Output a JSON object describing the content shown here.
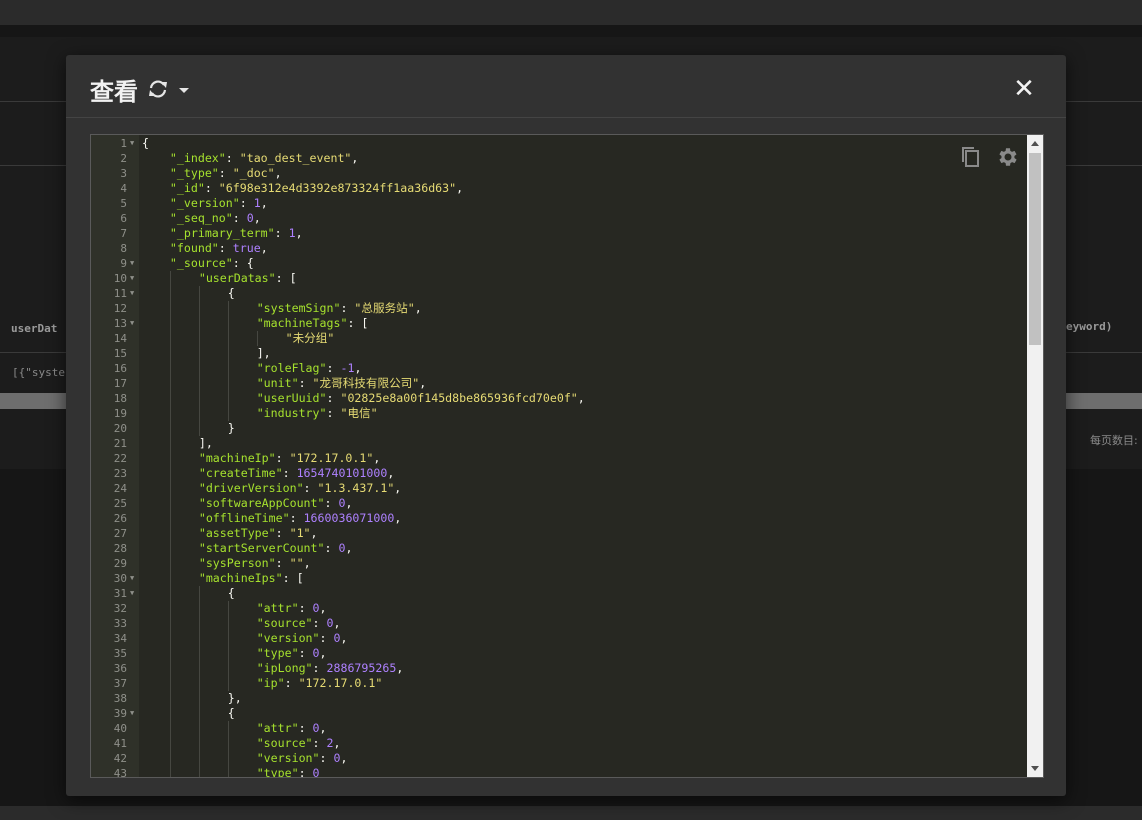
{
  "background": {
    "table_header_left": "userDat",
    "table_header_right": "eyword)",
    "table_cell_left": "[{\"syste",
    "pagination_label": "每页数目:"
  },
  "modal": {
    "title": "查看",
    "refresh_icon": "refresh-icon",
    "close_label": "✕"
  },
  "editor": {
    "copy_icon": "copy-icon",
    "settings_icon": "gear-icon",
    "colors": {
      "background": "#272822",
      "key": "#a6e22e",
      "string": "#e6db74",
      "number": "#ae81ff",
      "punctuation": "#f8f8f2"
    },
    "lines": [
      {
        "n": "1",
        "fold": true,
        "indent": 0,
        "tokens": [
          [
            "p",
            "{"
          ]
        ]
      },
      {
        "n": "2",
        "indent": 1,
        "tokens": [
          [
            "k",
            "\"_index\""
          ],
          [
            "p",
            ": "
          ],
          [
            "s",
            "\"tao_dest_event\""
          ],
          [
            "p",
            ","
          ]
        ]
      },
      {
        "n": "3",
        "indent": 1,
        "tokens": [
          [
            "k",
            "\"_type\""
          ],
          [
            "p",
            ": "
          ],
          [
            "s",
            "\"_doc\""
          ],
          [
            "p",
            ","
          ]
        ]
      },
      {
        "n": "4",
        "indent": 1,
        "tokens": [
          [
            "k",
            "\"_id\""
          ],
          [
            "p",
            ": "
          ],
          [
            "s",
            "\"6f98e312e4d3392e873324ff1aa36d63\""
          ],
          [
            "p",
            ","
          ]
        ]
      },
      {
        "n": "5",
        "indent": 1,
        "tokens": [
          [
            "k",
            "\"_version\""
          ],
          [
            "p",
            ": "
          ],
          [
            "n",
            "1"
          ],
          [
            "p",
            ","
          ]
        ]
      },
      {
        "n": "6",
        "indent": 1,
        "tokens": [
          [
            "k",
            "\"_seq_no\""
          ],
          [
            "p",
            ": "
          ],
          [
            "n",
            "0"
          ],
          [
            "p",
            ","
          ]
        ]
      },
      {
        "n": "7",
        "indent": 1,
        "tokens": [
          [
            "k",
            "\"_primary_term\""
          ],
          [
            "p",
            ": "
          ],
          [
            "n",
            "1"
          ],
          [
            "p",
            ","
          ]
        ]
      },
      {
        "n": "8",
        "indent": 1,
        "tokens": [
          [
            "k",
            "\"found\""
          ],
          [
            "p",
            ": "
          ],
          [
            "n",
            "true"
          ],
          [
            "p",
            ","
          ]
        ]
      },
      {
        "n": "9",
        "fold": true,
        "indent": 1,
        "tokens": [
          [
            "k",
            "\"_source\""
          ],
          [
            "p",
            ": {"
          ]
        ]
      },
      {
        "n": "10",
        "fold": true,
        "indent": 2,
        "tokens": [
          [
            "k",
            "\"userDatas\""
          ],
          [
            "p",
            ": ["
          ]
        ]
      },
      {
        "n": "11",
        "fold": true,
        "indent": 3,
        "tokens": [
          [
            "p",
            "{"
          ]
        ]
      },
      {
        "n": "12",
        "indent": 4,
        "tokens": [
          [
            "k",
            "\"systemSign\""
          ],
          [
            "p",
            ": "
          ],
          [
            "s",
            "\"总服务站\""
          ],
          [
            "p",
            ","
          ]
        ]
      },
      {
        "n": "13",
        "fold": true,
        "indent": 4,
        "tokens": [
          [
            "k",
            "\"machineTags\""
          ],
          [
            "p",
            ": ["
          ]
        ]
      },
      {
        "n": "14",
        "indent": 5,
        "tokens": [
          [
            "s",
            "\"未分组\""
          ]
        ]
      },
      {
        "n": "15",
        "indent": 4,
        "tokens": [
          [
            "p",
            "],"
          ]
        ]
      },
      {
        "n": "16",
        "indent": 4,
        "tokens": [
          [
            "k",
            "\"roleFlag\""
          ],
          [
            "p",
            ": "
          ],
          [
            "n",
            "-1"
          ],
          [
            "p",
            ","
          ]
        ]
      },
      {
        "n": "17",
        "indent": 4,
        "tokens": [
          [
            "k",
            "\"unit\""
          ],
          [
            "p",
            ": "
          ],
          [
            "s",
            "\"龙哥科技有限公司\""
          ],
          [
            "p",
            ","
          ]
        ]
      },
      {
        "n": "18",
        "indent": 4,
        "tokens": [
          [
            "k",
            "\"userUuid\""
          ],
          [
            "p",
            ": "
          ],
          [
            "s",
            "\"02825e8a00f145d8be865936fcd70e0f\""
          ],
          [
            "p",
            ","
          ]
        ]
      },
      {
        "n": "19",
        "indent": 4,
        "tokens": [
          [
            "k",
            "\"industry\""
          ],
          [
            "p",
            ": "
          ],
          [
            "s",
            "\"电信\""
          ]
        ]
      },
      {
        "n": "20",
        "indent": 3,
        "tokens": [
          [
            "p",
            "}"
          ]
        ]
      },
      {
        "n": "21",
        "indent": 2,
        "tokens": [
          [
            "p",
            "],"
          ]
        ]
      },
      {
        "n": "22",
        "indent": 2,
        "tokens": [
          [
            "k",
            "\"machineIp\""
          ],
          [
            "p",
            ": "
          ],
          [
            "s",
            "\"172.17.0.1\""
          ],
          [
            "p",
            ","
          ]
        ]
      },
      {
        "n": "23",
        "indent": 2,
        "tokens": [
          [
            "k",
            "\"createTime\""
          ],
          [
            "p",
            ": "
          ],
          [
            "n",
            "1654740101000"
          ],
          [
            "p",
            ","
          ]
        ]
      },
      {
        "n": "24",
        "indent": 2,
        "tokens": [
          [
            "k",
            "\"driverVersion\""
          ],
          [
            "p",
            ": "
          ],
          [
            "s",
            "\"1.3.437.1\""
          ],
          [
            "p",
            ","
          ]
        ]
      },
      {
        "n": "25",
        "indent": 2,
        "tokens": [
          [
            "k",
            "\"softwareAppCount\""
          ],
          [
            "p",
            ": "
          ],
          [
            "n",
            "0"
          ],
          [
            "p",
            ","
          ]
        ]
      },
      {
        "n": "26",
        "indent": 2,
        "tokens": [
          [
            "k",
            "\"offlineTime\""
          ],
          [
            "p",
            ": "
          ],
          [
            "n",
            "1660036071000"
          ],
          [
            "p",
            ","
          ]
        ]
      },
      {
        "n": "27",
        "indent": 2,
        "tokens": [
          [
            "k",
            "\"assetType\""
          ],
          [
            "p",
            ": "
          ],
          [
            "s",
            "\"1\""
          ],
          [
            "p",
            ","
          ]
        ]
      },
      {
        "n": "28",
        "indent": 2,
        "tokens": [
          [
            "k",
            "\"startServerCount\""
          ],
          [
            "p",
            ": "
          ],
          [
            "n",
            "0"
          ],
          [
            "p",
            ","
          ]
        ]
      },
      {
        "n": "29",
        "indent": 2,
        "tokens": [
          [
            "k",
            "\"sysPerson\""
          ],
          [
            "p",
            ": "
          ],
          [
            "s",
            "\"\""
          ],
          [
            "p",
            ","
          ]
        ]
      },
      {
        "n": "30",
        "fold": true,
        "indent": 2,
        "tokens": [
          [
            "k",
            "\"machineIps\""
          ],
          [
            "p",
            ": ["
          ]
        ]
      },
      {
        "n": "31",
        "fold": true,
        "indent": 3,
        "tokens": [
          [
            "p",
            "{"
          ]
        ]
      },
      {
        "n": "32",
        "indent": 4,
        "tokens": [
          [
            "k",
            "\"attr\""
          ],
          [
            "p",
            ": "
          ],
          [
            "n",
            "0"
          ],
          [
            "p",
            ","
          ]
        ]
      },
      {
        "n": "33",
        "indent": 4,
        "tokens": [
          [
            "k",
            "\"source\""
          ],
          [
            "p",
            ": "
          ],
          [
            "n",
            "0"
          ],
          [
            "p",
            ","
          ]
        ]
      },
      {
        "n": "34",
        "indent": 4,
        "tokens": [
          [
            "k",
            "\"version\""
          ],
          [
            "p",
            ": "
          ],
          [
            "n",
            "0"
          ],
          [
            "p",
            ","
          ]
        ]
      },
      {
        "n": "35",
        "indent": 4,
        "tokens": [
          [
            "k",
            "\"type\""
          ],
          [
            "p",
            ": "
          ],
          [
            "n",
            "0"
          ],
          [
            "p",
            ","
          ]
        ]
      },
      {
        "n": "36",
        "indent": 4,
        "tokens": [
          [
            "k",
            "\"ipLong\""
          ],
          [
            "p",
            ": "
          ],
          [
            "n",
            "2886795265"
          ],
          [
            "p",
            ","
          ]
        ]
      },
      {
        "n": "37",
        "indent": 4,
        "tokens": [
          [
            "k",
            "\"ip\""
          ],
          [
            "p",
            ": "
          ],
          [
            "s",
            "\"172.17.0.1\""
          ]
        ]
      },
      {
        "n": "38",
        "indent": 3,
        "tokens": [
          [
            "p",
            "},"
          ]
        ]
      },
      {
        "n": "39",
        "fold": true,
        "indent": 3,
        "tokens": [
          [
            "p",
            "{"
          ]
        ]
      },
      {
        "n": "40",
        "indent": 4,
        "tokens": [
          [
            "k",
            "\"attr\""
          ],
          [
            "p",
            ": "
          ],
          [
            "n",
            "0"
          ],
          [
            "p",
            ","
          ]
        ]
      },
      {
        "n": "41",
        "indent": 4,
        "tokens": [
          [
            "k",
            "\"source\""
          ],
          [
            "p",
            ": "
          ],
          [
            "n",
            "2"
          ],
          [
            "p",
            ","
          ]
        ]
      },
      {
        "n": "42",
        "indent": 4,
        "tokens": [
          [
            "k",
            "\"version\""
          ],
          [
            "p",
            ": "
          ],
          [
            "n",
            "0"
          ],
          [
            "p",
            ","
          ]
        ]
      },
      {
        "n": "43",
        "indent": 4,
        "tokens": [
          [
            "k",
            "\"type\""
          ],
          [
            "p",
            ": "
          ],
          [
            "n",
            "0"
          ]
        ]
      }
    ]
  }
}
